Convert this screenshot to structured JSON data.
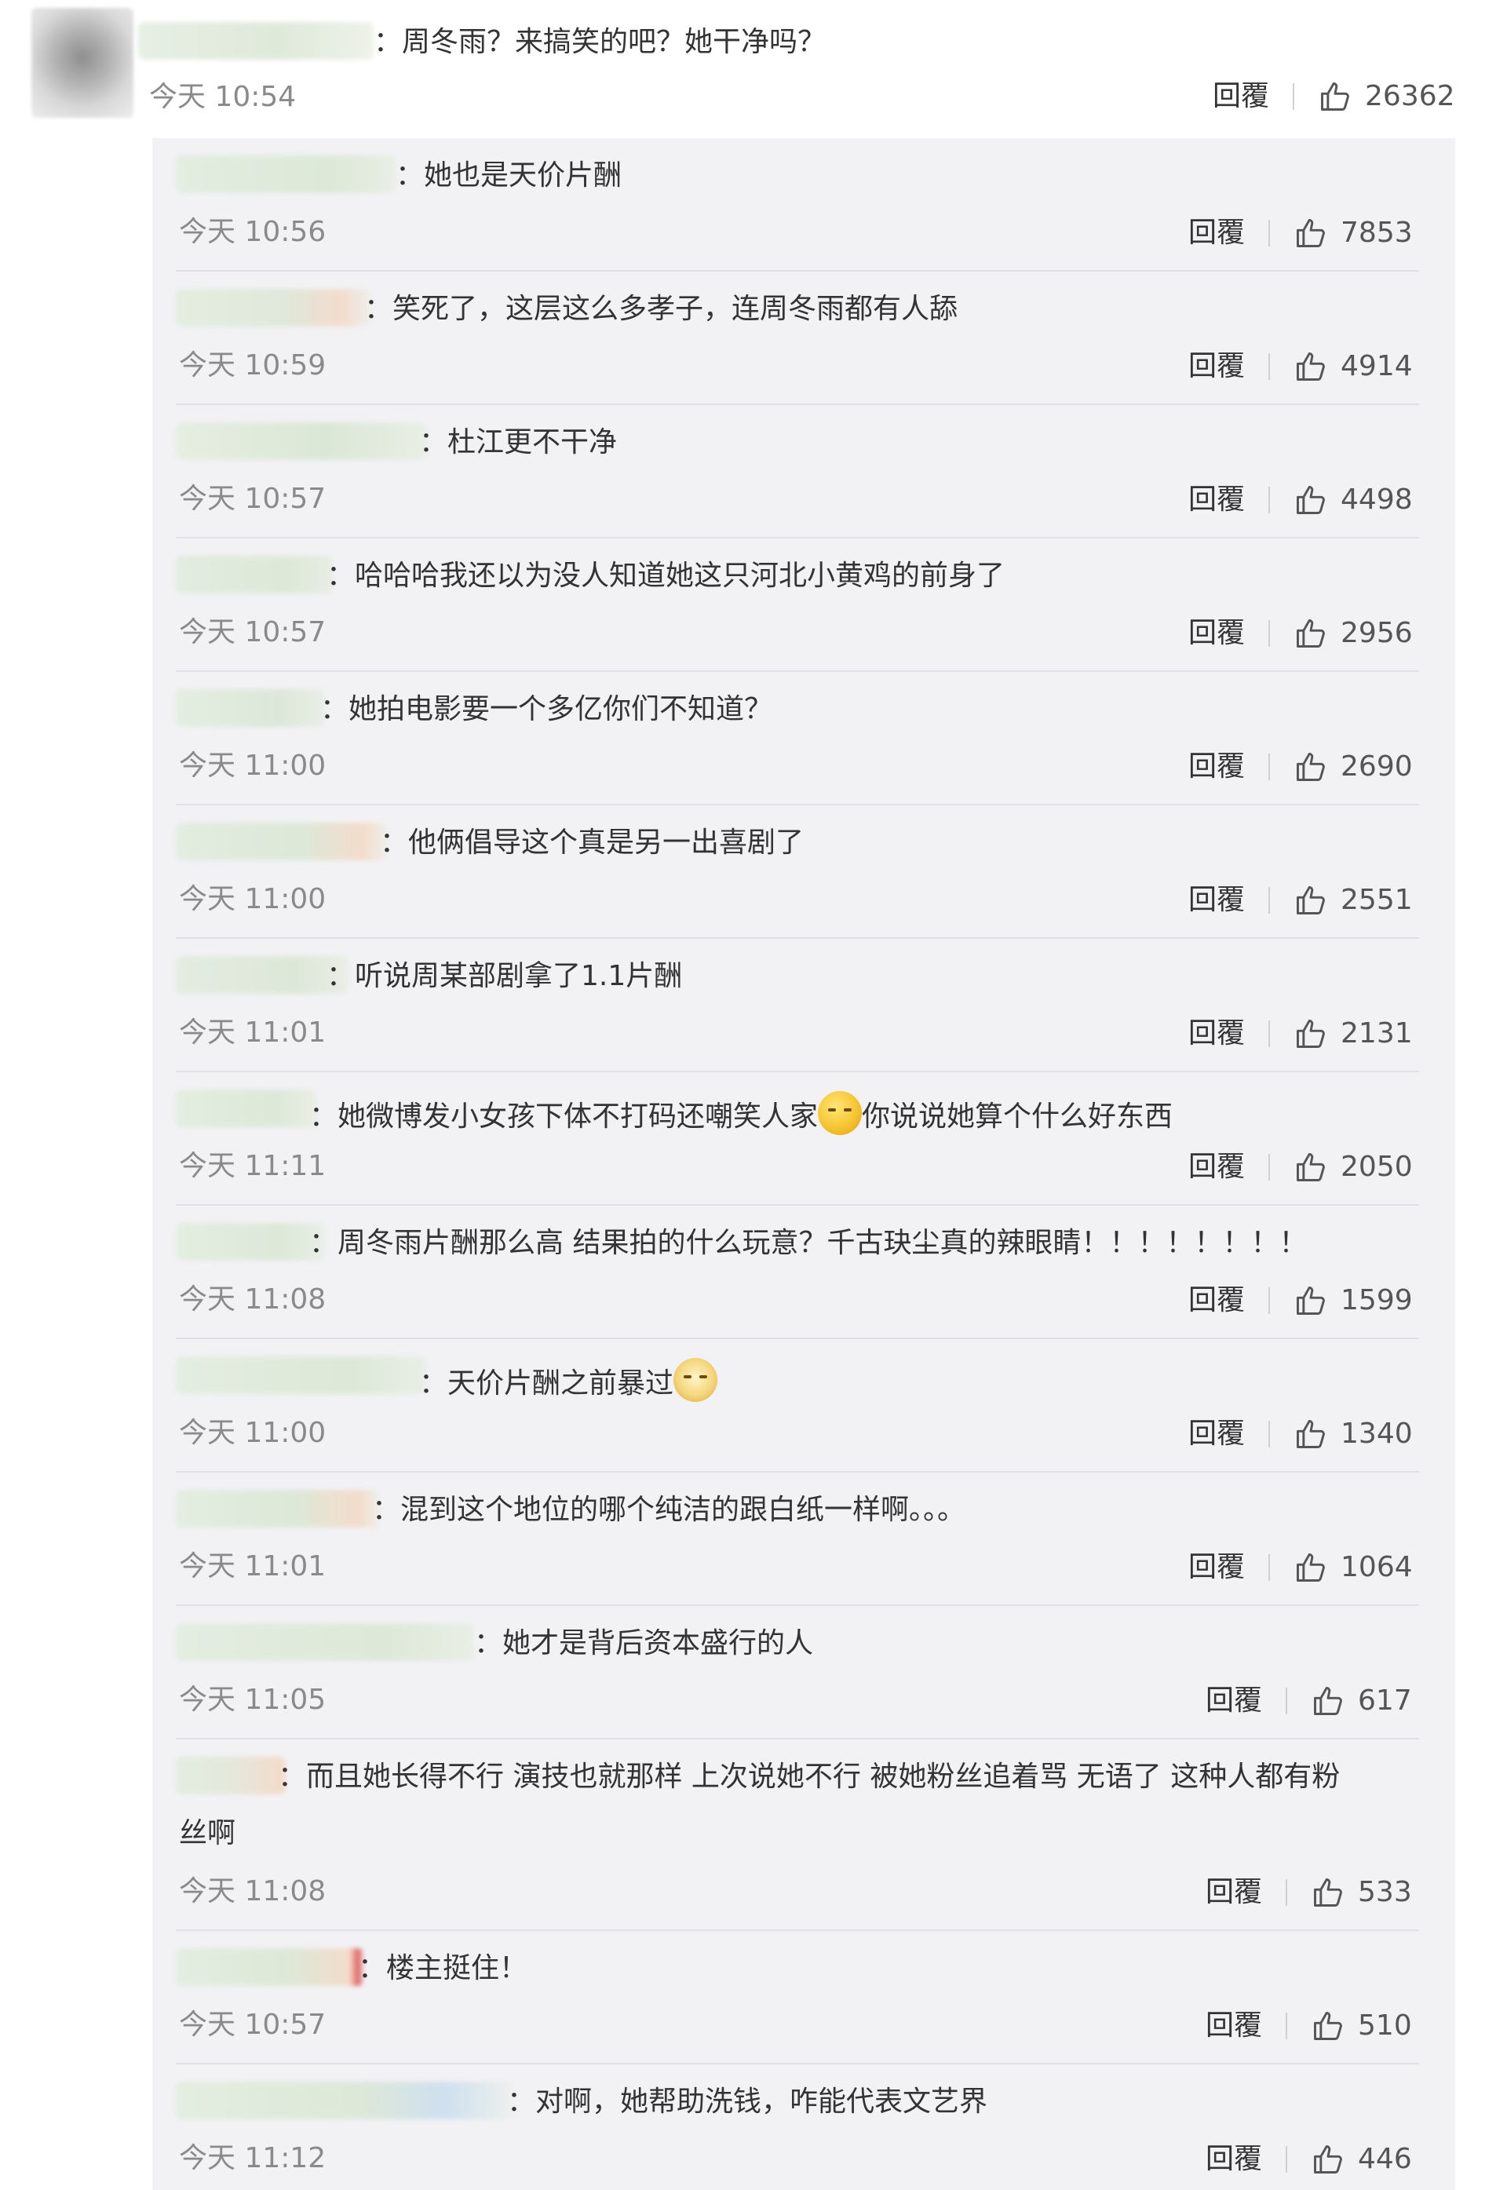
{
  "main": {
    "text": "：周冬雨？来搞笑的吧？她干净吗？",
    "time": "今天 10:54",
    "reply": "回覆",
    "likes": "26362"
  },
  "replies": [
    {
      "text": "：她也是天价片酬",
      "time": "今天 10:56",
      "reply": "回覆",
      "likes": "7853"
    },
    {
      "text": "：笑死了，这层这么多孝子，连周冬雨都有人舔",
      "time": "今天 10:59",
      "reply": "回覆",
      "likes": "4914"
    },
    {
      "text": "：杜江更不干净",
      "time": "今天 10:57",
      "reply": "回覆",
      "likes": "4498"
    },
    {
      "text": "：哈哈哈我还以为没人知道她这只河北小黄鸡的前身了",
      "time": "今天 10:57",
      "reply": "回覆",
      "likes": "2956"
    },
    {
      "text": "：她拍电影要一个多亿你们不知道？",
      "time": "今天 11:00",
      "reply": "回覆",
      "likes": "2690"
    },
    {
      "text": "：他俩倡导这个真是另一出喜剧了",
      "time": "今天 11:00",
      "reply": "回覆",
      "likes": "2551"
    },
    {
      "text": "：听说周某部剧拿了1.1片酬",
      "time": "今天 11:01",
      "reply": "回覆",
      "likes": "2131"
    },
    {
      "text": "：她微博发小女孩下体不打码还嘲笑人家",
      "text2": "你说说她算个什么好东西",
      "emoji": "think-emoji",
      "time": "今天 11:11",
      "reply": "回覆",
      "likes": "2050"
    },
    {
      "text": "：周冬雨片酬那么高 结果拍的什么玩意？千古玦尘真的辣眼睛！！！！！！！！",
      "time": "今天 11:08",
      "reply": "回覆",
      "likes": "1599"
    },
    {
      "text": "：天价片酬之前暴过",
      "emoji": "doge-emoji",
      "time": "今天 11:00",
      "reply": "回覆",
      "likes": "1340"
    },
    {
      "text": "：混到这个地位的哪个纯洁的跟白纸一样啊。。。",
      "time": "今天 11:01",
      "reply": "回覆",
      "likes": "1064"
    },
    {
      "text": "：她才是背后资本盛行的人",
      "time": "今天 11:05",
      "reply": "回覆",
      "likes": "617"
    },
    {
      "text": "：而且她长得不行 演技也就那样 上次说她不行 被她粉丝追着骂 无语了 这种人都有粉",
      "text2": "丝啊",
      "time": "今天 11:08",
      "reply": "回覆",
      "likes": "533"
    },
    {
      "text": "：楼主挺住！",
      "time": "今天 10:57",
      "reply": "回覆",
      "likes": "510"
    },
    {
      "text": "：对啊，她帮助洗钱，咋能代表文艺界",
      "time": "今天 11:12",
      "reply": "回覆",
      "likes": "446"
    }
  ],
  "icons": {
    "like": "thumbs-up-icon"
  }
}
